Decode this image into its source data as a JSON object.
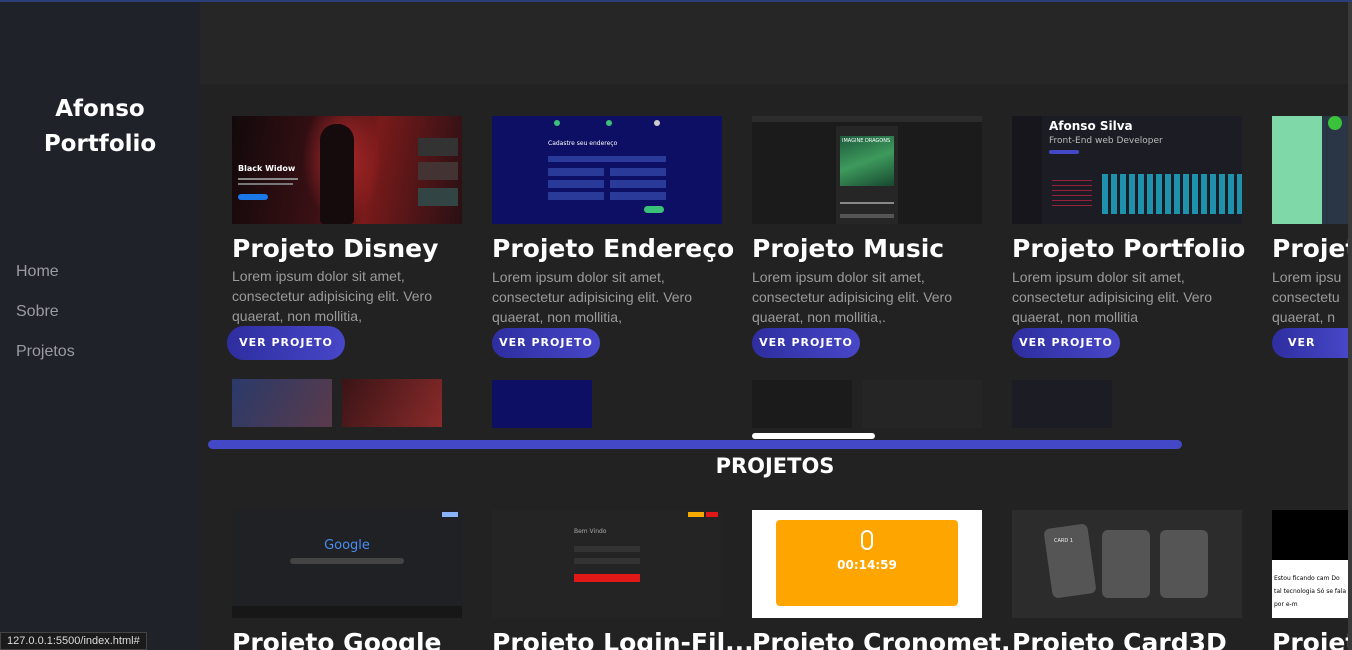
{
  "sidebar": {
    "brand_line1": "Afonso",
    "brand_line2": "Portfolio",
    "nav": [
      "Home",
      "Sobre",
      "Projetos"
    ]
  },
  "cards": [
    {
      "title": "Projeto Disney",
      "desc": "Lorem ipsum dolor sit amet, consectetur adipisicing elit. Vero quaerat, non mollitia,",
      "button": "VER PROJETO",
      "thumb_title": "Black Widow"
    },
    {
      "title": "Projeto Endereço",
      "desc": "Lorem ipsum dolor sit amet, consectetur adipisicing elit. Vero quaerat, non mollitia,",
      "button": "VER PROJETO",
      "thumb_title": "Cadastre seu endereço"
    },
    {
      "title": "Projeto Music",
      "desc": "Lorem ipsum dolor sit amet, consectetur adipisicing elit. Vero quaerat, non mollitia,.",
      "button": "VER PROJETO",
      "thumb_title": "IMAGINE DRAGONS"
    },
    {
      "title": "Projeto Portfolio",
      "desc": "Lorem ipsum dolor sit amet, consectetur adipisicing elit. Vero quaerat, non mollitia",
      "button": "VER PROJETO",
      "thumb_title": "Afonso Silva",
      "thumb_subtitle": "Front-End web Developer"
    },
    {
      "title": "Projet",
      "desc": "Lorem ipsu consectetu quaerat, n",
      "button": "VER PROJ"
    }
  ],
  "section_title": "PROJETOS",
  "projects": [
    {
      "title": "Projeto Google",
      "thumb_text": "Google"
    },
    {
      "title": "Projeto Login-Fil...",
      "thumb_text": "Bem Vindo"
    },
    {
      "title": "Projeto Cronomet.",
      "thumb_text": "00:14:59"
    },
    {
      "title": "Projeto Card3D",
      "thumb_text": "CARD 1"
    },
    {
      "title": "Projet",
      "thumb_text": "Estou ficando cam Do tal tecnologia Só se fala por e-m"
    }
  ],
  "status_url": "127.0.0.1:5500/index.html#",
  "colors": {
    "accent": "#4348c6",
    "sidebar": "#1f2229",
    "cronometro": "#ffa500"
  }
}
